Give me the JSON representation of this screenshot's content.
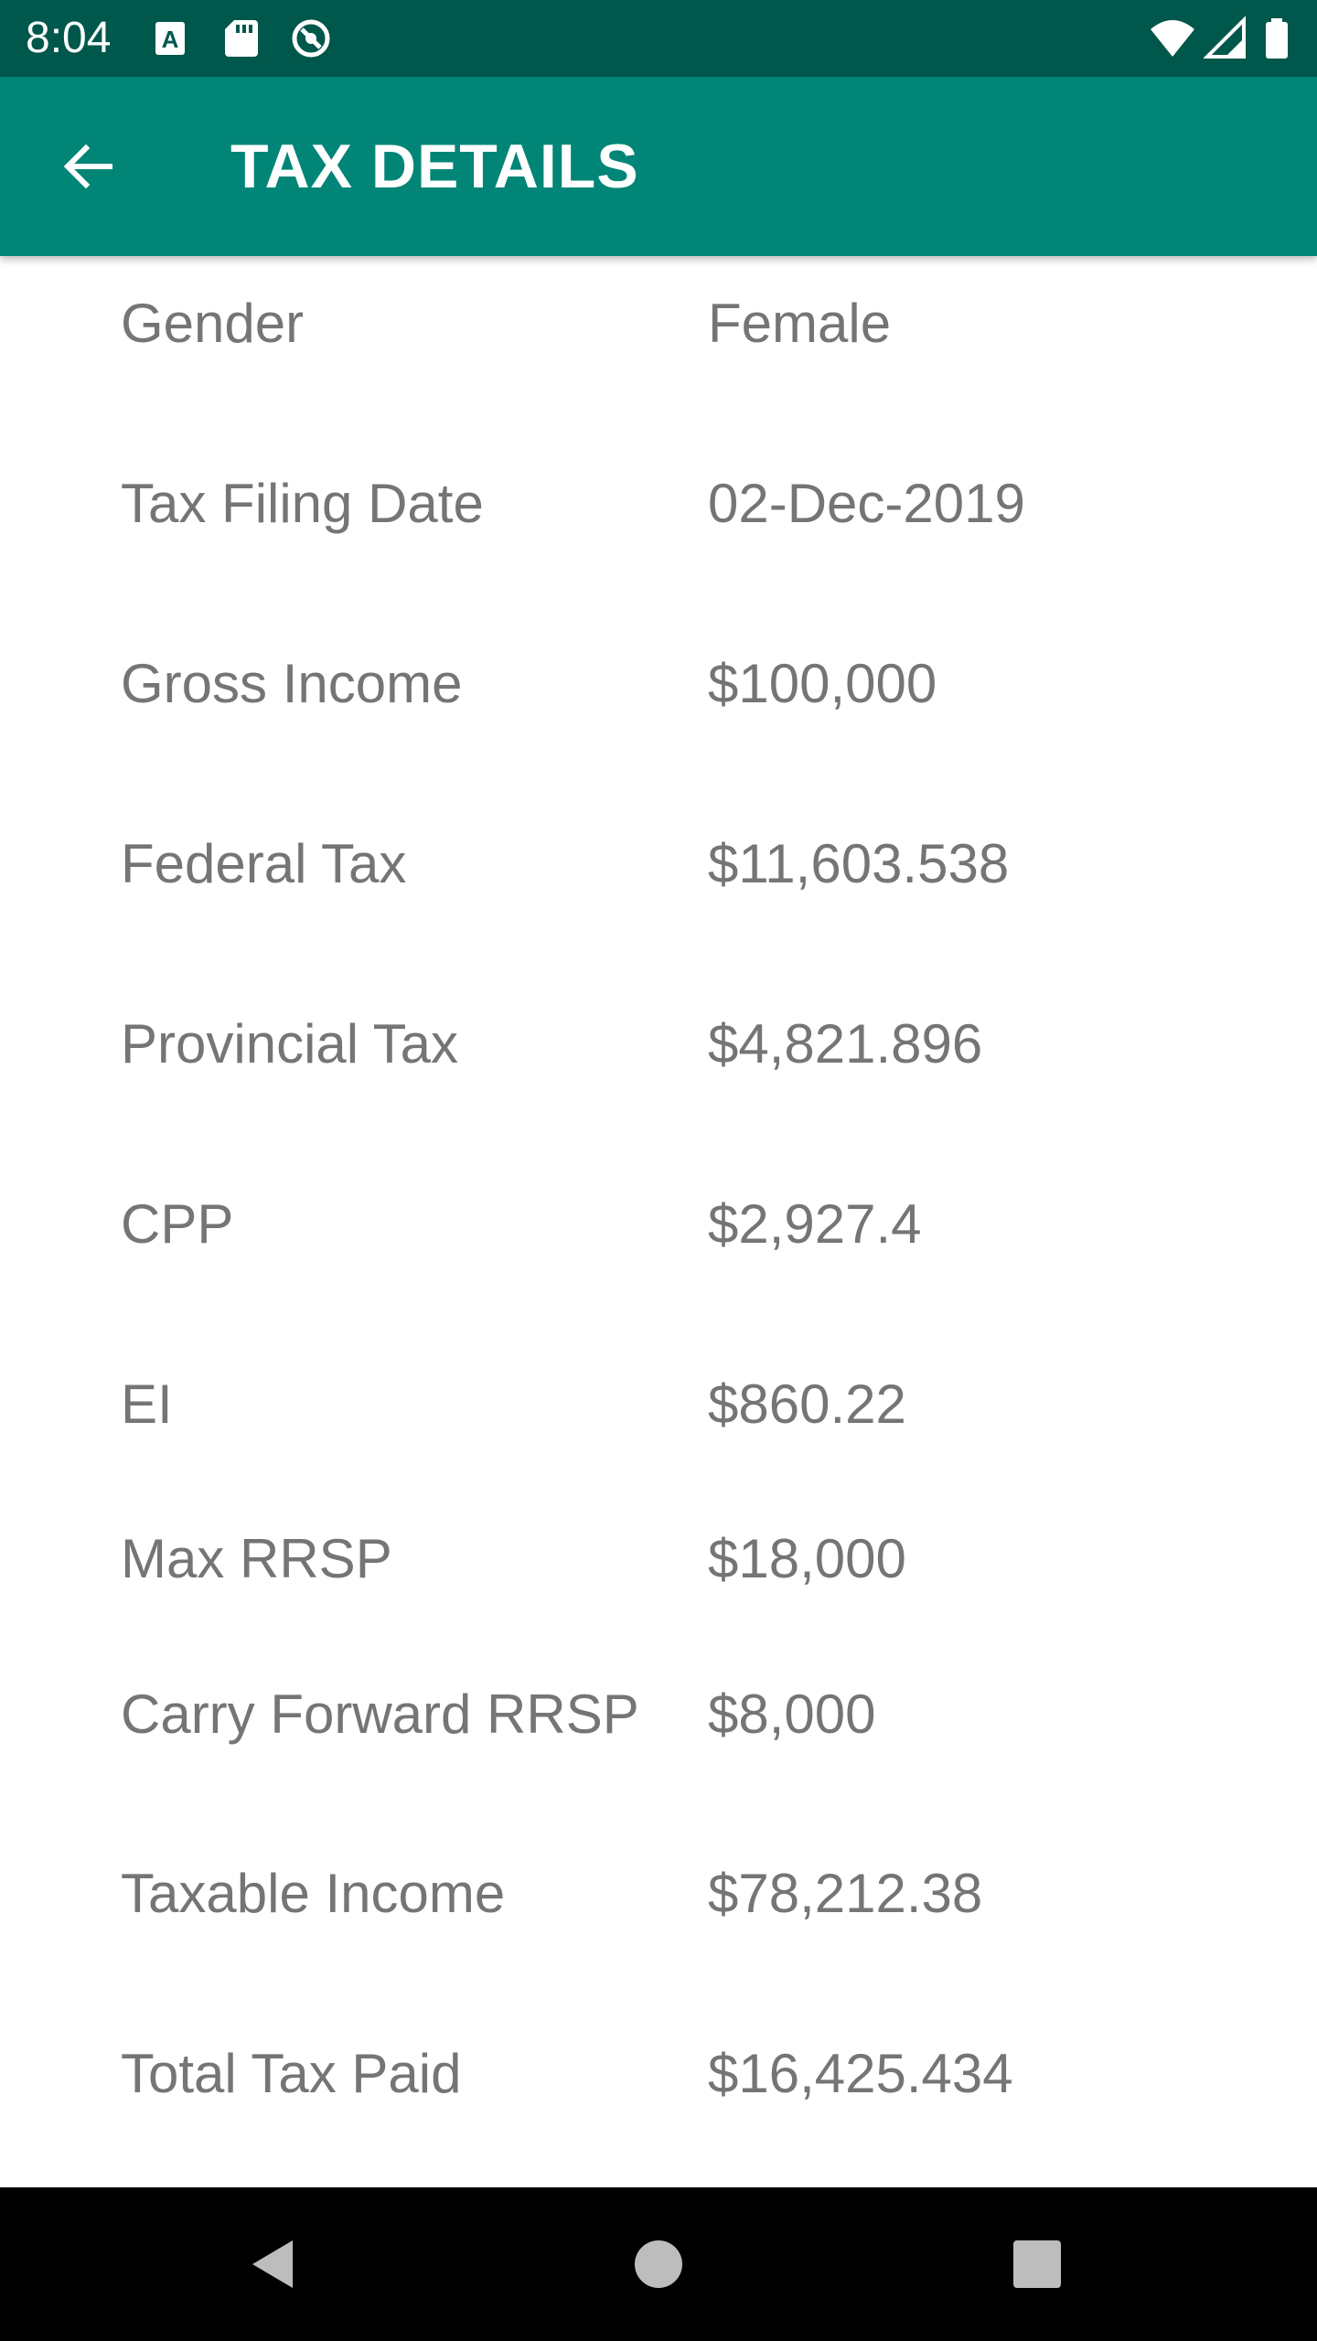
{
  "status_bar": {
    "time": "8:04",
    "left_icons": [
      "a-icon",
      "sd-card-icon",
      "sync-icon"
    ],
    "right_icons": [
      "wifi-icon",
      "signal-icon",
      "battery-icon"
    ]
  },
  "app_bar": {
    "title": "TAX DETAILS",
    "back_icon": "arrow-back-icon",
    "background": "#008577",
    "status_background": "#00574b"
  },
  "details": [
    {
      "label": "Gender",
      "value": "Female"
    },
    {
      "label": "Tax Filing Date",
      "value": "02-Dec-2019"
    },
    {
      "label": "Gross Income",
      "value": "$100,000"
    },
    {
      "label": "Federal Tax",
      "value": "$11,603.538"
    },
    {
      "label": "Provincial Tax",
      "value": "$4,821.896"
    },
    {
      "label": "CPP",
      "value": "$2,927.4"
    },
    {
      "label": "EI",
      "value": "$860.22"
    },
    {
      "label": "Max RRSP",
      "value": "$18,000"
    },
    {
      "label": "Carry Forward RRSP",
      "value": "$8,000"
    },
    {
      "label": "Taxable Income",
      "value": "$78,212.38"
    },
    {
      "label": "Total Tax Paid",
      "value": "$16,425.434"
    }
  ],
  "nav_bar": {
    "buttons": [
      "back-triangle-icon",
      "home-circle-icon",
      "recents-square-icon"
    ]
  }
}
